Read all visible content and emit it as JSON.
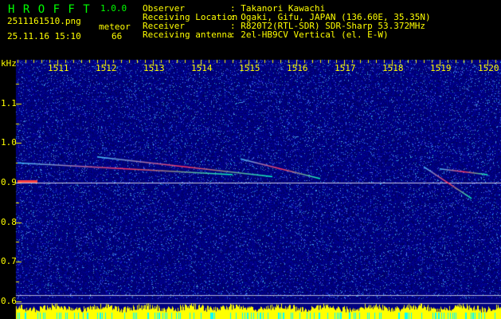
{
  "header": {
    "app_name": "H R O F F T",
    "version": "1.0.0",
    "filename": "2511161510.png",
    "datetime": "25.11.16 15:10",
    "meteor_label": "meteor",
    "meteor_count": "66",
    "info": [
      {
        "label": "Observer",
        "value": ": Takanori Kawachi"
      },
      {
        "label": "Receiving Location",
        "value": ": Ogaki, Gifu, JAPAN (136.60E, 35.35N)"
      },
      {
        "label": "Receiver",
        "value": ": R820T2(RTL-SDR) SDR-Sharp 53.372MHz"
      },
      {
        "label": "Receiving antenna",
        "value": ": 2el-HB9CV Vertical (el. E-W)"
      }
    ]
  },
  "colors": {
    "text": "#ffff00",
    "title": "#00ff00",
    "background": "#000080",
    "amplitude": "#ffff00",
    "baseline": "#00ffff"
  },
  "chart_data": {
    "type": "heatmap",
    "ylabel": "kHz",
    "x_ticks": [
      "1511",
      "1512",
      "1513",
      "1514",
      "1515",
      "1516",
      "1517",
      "1518",
      "1519",
      "1520"
    ],
    "y_ticks": [
      "1.1",
      "1.0",
      "0.9",
      "0.8",
      "0.7",
      "0.6"
    ],
    "xlim": [
      "1510",
      "1520"
    ],
    "ylim": [
      0.58,
      1.2
    ],
    "carrier_khz": 0.9,
    "meteor_traces": [
      {
        "start": "1510:10",
        "end": "1514:40",
        "f_start": 0.95,
        "f_end": 0.92
      },
      {
        "start": "1511:50",
        "end": "1515:30",
        "f_start": 0.965,
        "f_end": 0.915
      },
      {
        "start": "1514:50",
        "end": "1516:30",
        "f_start": 0.96,
        "f_end": 0.91
      },
      {
        "start": "1518:40",
        "end": "1519:40",
        "f_start": 0.94,
        "f_end": 0.86
      },
      {
        "start": "1519:00",
        "end": "1520:00",
        "f_start": 0.935,
        "f_end": 0.92
      }
    ]
  }
}
